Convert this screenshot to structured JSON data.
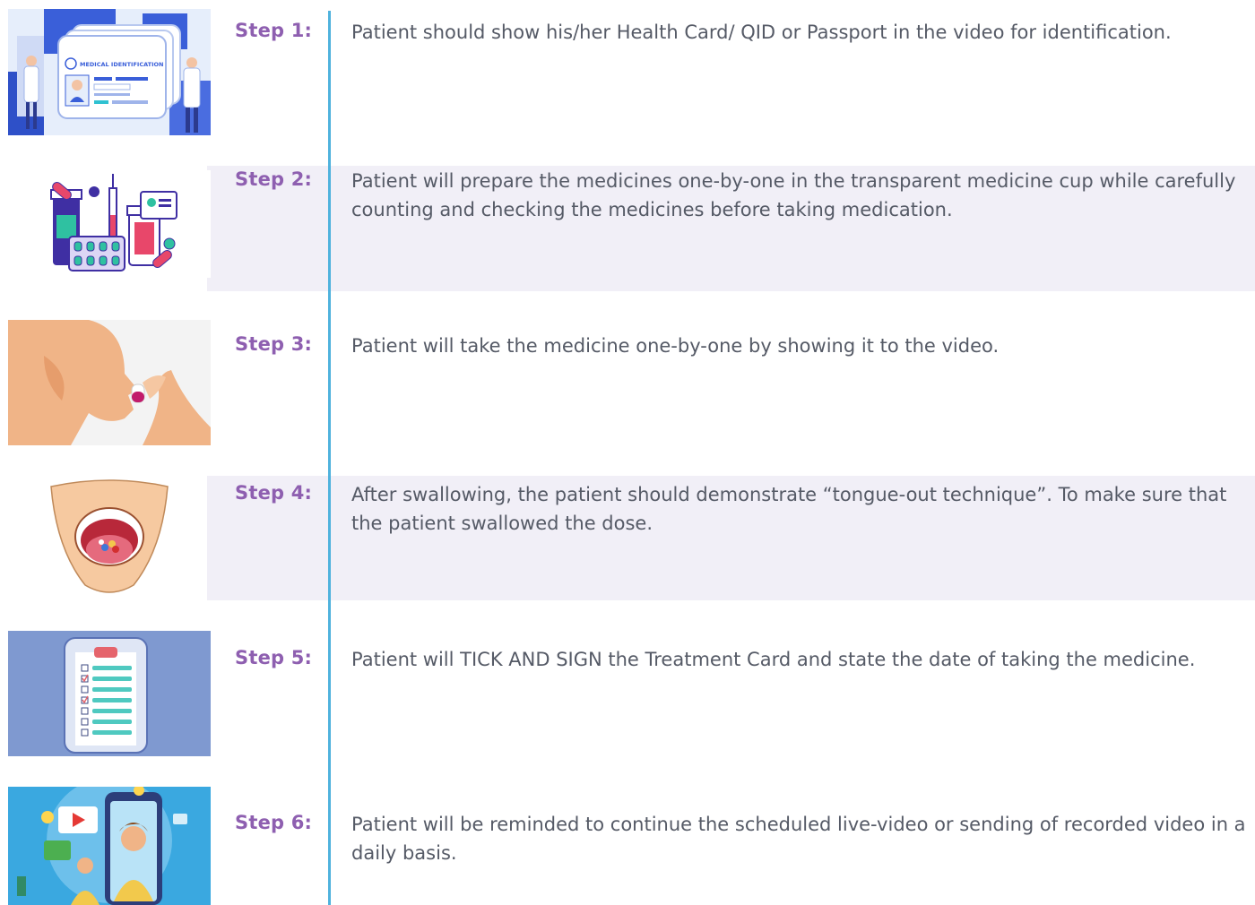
{
  "steps": [
    {
      "label": "Step 1:",
      "text": "Patient should show his/her Health Card/ QID or Passport in the video for identification.",
      "illustration": "medical-id-card",
      "card_text": "MEDICAL IDENTIFICATION"
    },
    {
      "label": "Step 2:",
      "text": "Patient will prepare the medicines one-by-one in the transparent medicine cup while carefully counting and checking the medicines before taking medication.",
      "illustration": "medicines"
    },
    {
      "label": "Step 3:",
      "text": "Patient will take the medicine one-by-one by showing it to the video.",
      "illustration": "person-taking-pill"
    },
    {
      "label": "Step 4:",
      "text": "After swallowing, the patient should demonstrate “tongue-out technique”. To make sure that the patient swallowed the dose.",
      "illustration": "open-mouth"
    },
    {
      "label": "Step 5:",
      "text": "Patient will TICK AND SIGN the Treatment Card and state the date of taking the medicine.",
      "illustration": "clipboard-checklist"
    },
    {
      "label": "Step 6:",
      "text": "Patient will be reminded to continue the scheduled live-video or sending of recorded video in a daily basis.",
      "illustration": "video-call"
    }
  ],
  "colors": {
    "step_label": "#8e5fb0",
    "body_text": "#555a66",
    "divider": "#4fb2dd",
    "band": "#f1eff7"
  }
}
